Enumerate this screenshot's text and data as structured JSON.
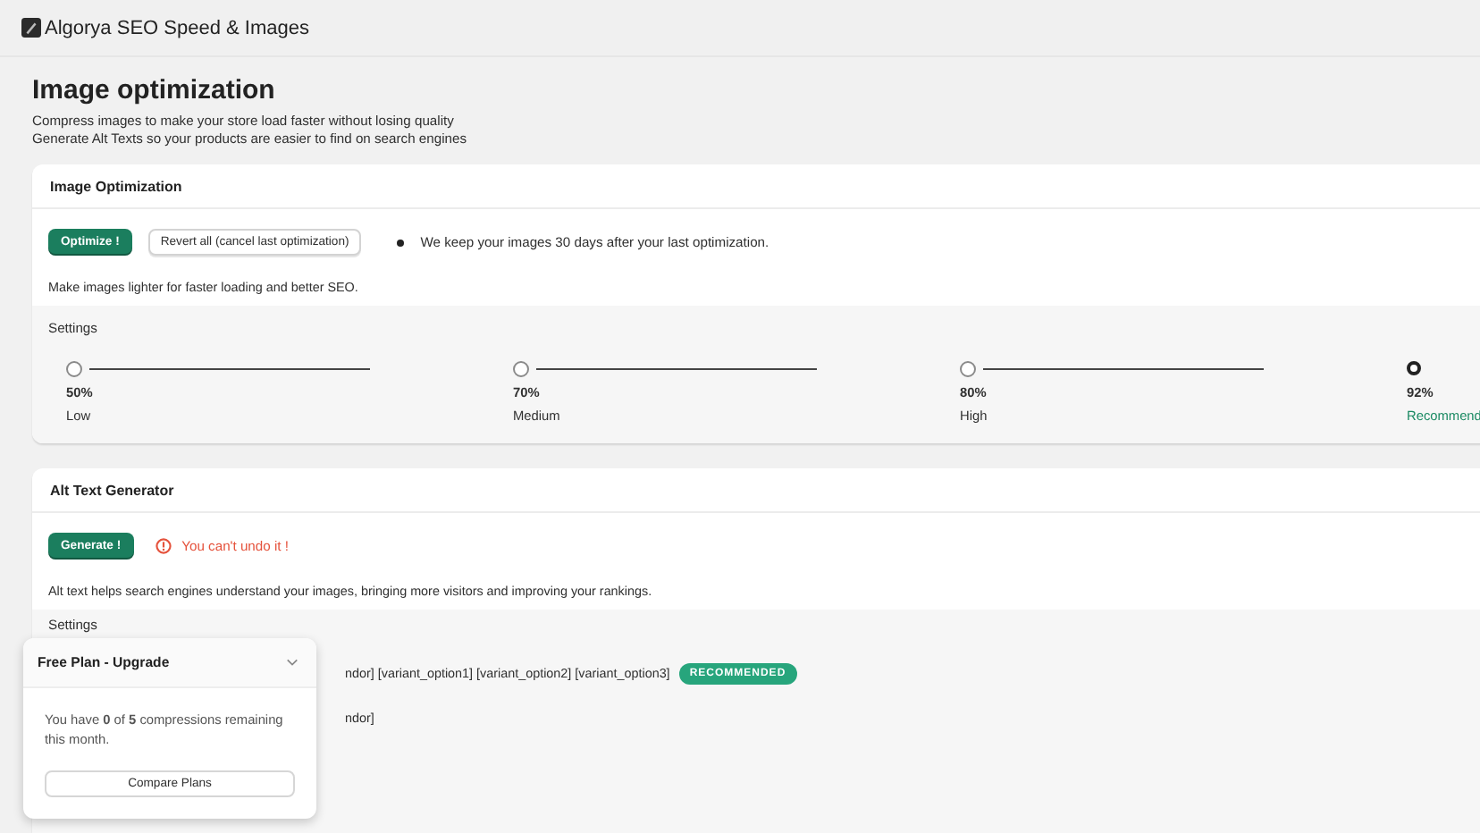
{
  "app": {
    "title": "Algorya SEO Speed & Images"
  },
  "page": {
    "title": "Image optimization",
    "description": [
      "Compress images to make your store load faster without losing quality",
      "Generate Alt Texts so your products are easier to find on search engines"
    ]
  },
  "image_optimization": {
    "title": "Image Optimization",
    "primary_button": "Optimize !",
    "secondary_button": "Revert all (cancel last optimization)",
    "note": "We keep your images 30 days after your last optimization.",
    "description": "Make images lighter for faster loading and better SEO.",
    "settings_title": "Settings",
    "levels": [
      {
        "value": "50%",
        "label": "Low",
        "selected": false,
        "highlight": false
      },
      {
        "value": "70%",
        "label": "Medium",
        "selected": false,
        "highlight": false
      },
      {
        "value": "80%",
        "label": "High",
        "selected": false,
        "highlight": false
      },
      {
        "value": "92%",
        "label": "Recommend",
        "selected": true,
        "highlight": true
      }
    ]
  },
  "alt_text": {
    "title": "Alt Text Generator",
    "primary_button": "Generate !",
    "warning": "You can't undo it !",
    "description": "Alt text helps search engines understand your images, bringing more visitors and improving your rankings.",
    "settings_title": "Settings",
    "options": [
      {
        "text": "ndor] [variant_option1] [variant_option2] [variant_option3]",
        "badge": "RECOMMENDED"
      },
      {
        "text": "ndor]"
      }
    ]
  },
  "plan_popup": {
    "title": "Free Plan - Upgrade",
    "message": "You have **0** of **5** compressions remaining this month.",
    "button": "Compare Plans"
  }
}
